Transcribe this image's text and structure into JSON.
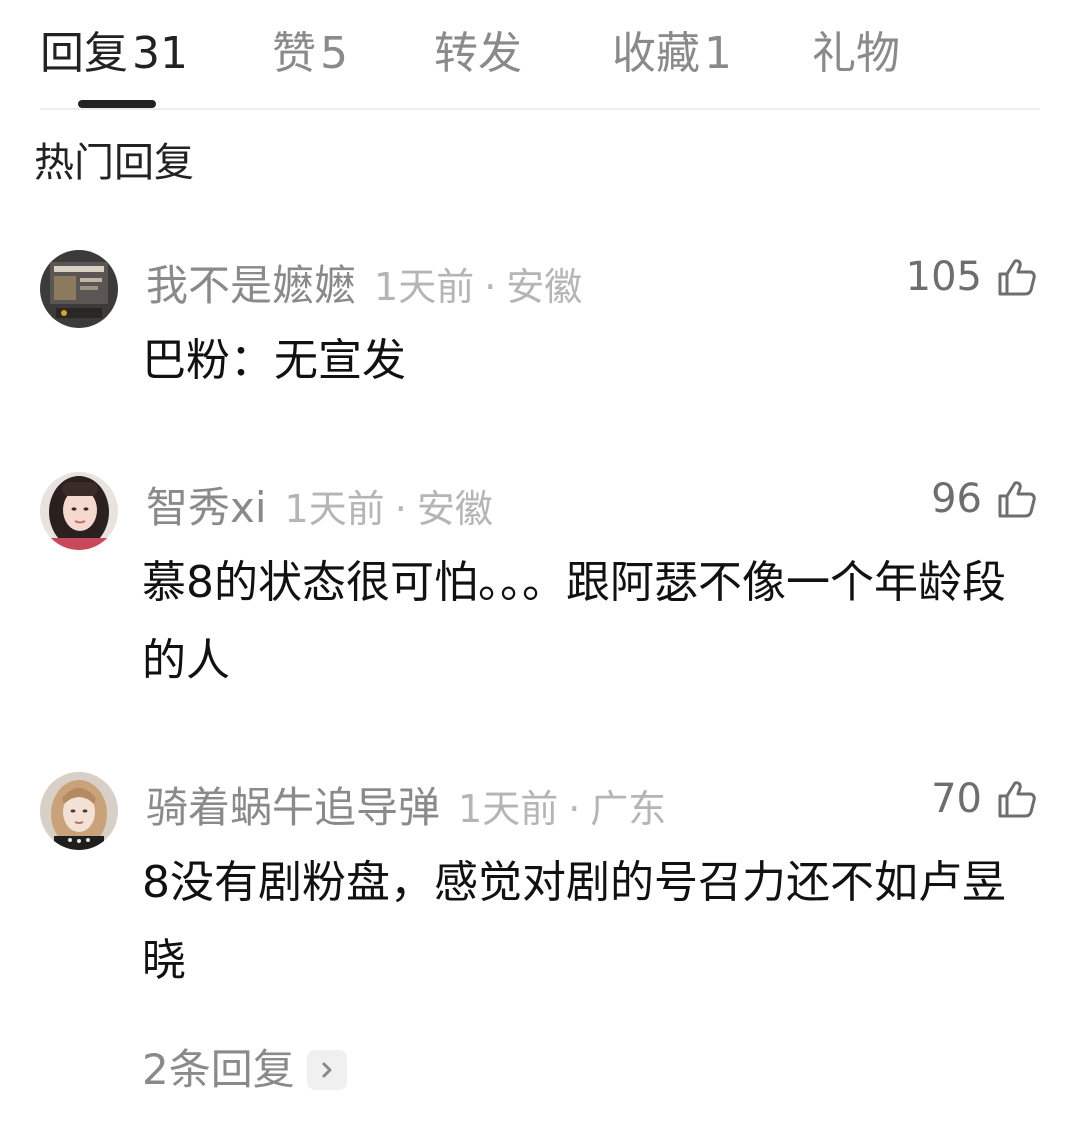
{
  "tabs": [
    {
      "label": "回复",
      "count": "31",
      "active": true
    },
    {
      "label": "赞",
      "count": "5",
      "active": false
    },
    {
      "label": "转发",
      "count": "",
      "active": false
    },
    {
      "label": "收藏",
      "count": "1",
      "active": false
    },
    {
      "label": "礼物",
      "count": "",
      "active": false
    }
  ],
  "section_title": "热门回复",
  "comments": [
    {
      "username": "我不是嬷嬷",
      "time": "1天前",
      "location": "安徽",
      "likes": "105",
      "text": "巴粉：无宣发",
      "avatar_icon": "avatar-icon"
    },
    {
      "username": "智秀xi",
      "time": "1天前",
      "location": "安徽",
      "likes": "96",
      "text": "慕8的状态很可怕。。。跟阿瑟不像一个年龄段的人",
      "avatar_icon": "avatar-icon"
    },
    {
      "username": "骑着蜗牛追导弹",
      "time": "1天前",
      "location": "广东",
      "likes": "70",
      "text": "8没有剧粉盘，感觉对剧的号召力还不如卢昱晓",
      "avatar_icon": "avatar-icon"
    }
  ],
  "more_replies": "2条回复",
  "separator": "·",
  "icons": {
    "like": "thumbs-up-icon",
    "chevron": "chevron-right-icon"
  },
  "colors": {
    "text_primary": "#222222",
    "text_secondary": "#8a8a8a",
    "text_tertiary": "#b5b5b5",
    "divider": "#ececec"
  }
}
